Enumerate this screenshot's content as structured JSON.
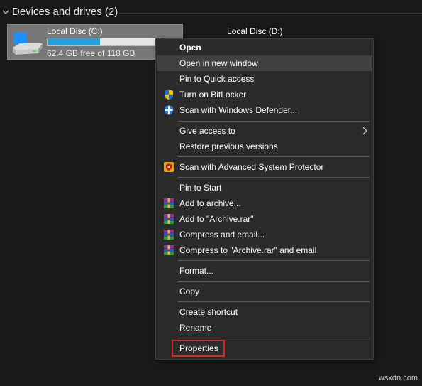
{
  "section": {
    "title": "Devices and drives (2)"
  },
  "drives": [
    {
      "name": "Local Disc (C:)",
      "free_text": "62.4 GB free of 118 GB",
      "used_fraction": 0.47,
      "selected": true
    },
    {
      "name": "Local Disc (D:)"
    }
  ],
  "menu": {
    "items": [
      {
        "label": "Open"
      },
      {
        "label": "Open in new window"
      },
      {
        "label": "Pin to Quick access"
      },
      {
        "label": "Turn on BitLocker",
        "icon": "shield-bitlocker-icon"
      },
      {
        "label": "Scan with Windows Defender...",
        "icon": "windows-defender-icon"
      },
      {
        "label": "Give access to",
        "submenu": true
      },
      {
        "label": "Restore previous versions"
      },
      {
        "label": "Scan with Advanced System Protector",
        "icon": "system-protector-icon"
      },
      {
        "label": "Pin to Start"
      },
      {
        "label": "Add to archive...",
        "icon": "winrar-icon"
      },
      {
        "label": "Add to \"Archive.rar\"",
        "icon": "winrar-icon"
      },
      {
        "label": "Compress and email...",
        "icon": "winrar-icon"
      },
      {
        "label": "Compress to \"Archive.rar\" and email",
        "icon": "winrar-icon"
      },
      {
        "label": "Format..."
      },
      {
        "label": "Copy"
      },
      {
        "label": "Create shortcut"
      },
      {
        "label": "Rename"
      },
      {
        "label": "Properties"
      }
    ]
  },
  "colors": {
    "accent": "#26a0da",
    "highlight": "#d9262c",
    "menu_bg": "#2b2b2b",
    "hover": "#414141"
  },
  "watermark": "wsxdn.com"
}
